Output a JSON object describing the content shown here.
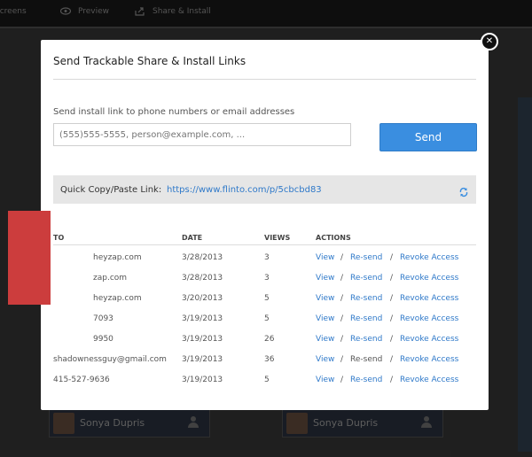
{
  "background": {
    "toolbar": {
      "screens_label": "Screens",
      "preview_label": "Preview",
      "share_label": "Share & Install"
    },
    "cards": [
      {
        "name": "Sonya Dupris"
      },
      {
        "name": "Sonya Dupris"
      }
    ]
  },
  "modal": {
    "title": "Send Trackable Share & Install Links",
    "instruction": "Send install link to phone numbers or email addresses",
    "input_placeholder": "(555)555-5555, person@example.com, ...",
    "send_label": "Send",
    "quick_label": "Quick Copy/Paste Link:",
    "quick_link": "https://www.flinto.com/p/5cbcbd83",
    "table": {
      "headers": {
        "to": "TO",
        "date": "DATE",
        "views": "VIEWS",
        "actions": "ACTIONS"
      },
      "rows": [
        {
          "to": "heyzap.com",
          "date": "3/28/2013",
          "views": "3",
          "view": "View",
          "resend": "Re-send",
          "revoke": "Revoke Access"
        },
        {
          "to": "zap.com",
          "date": "3/28/2013",
          "views": "3",
          "view": "View",
          "resend": "Re-send",
          "revoke": "Revoke Access"
        },
        {
          "to": "heyzap.com",
          "date": "3/20/2013",
          "views": "5",
          "view": "View",
          "resend": "Re-send",
          "revoke": "Revoke Access"
        },
        {
          "to": "7093",
          "date": "3/19/2013",
          "views": "5",
          "view": "View",
          "resend": "Re-send",
          "revoke": "Revoke Access"
        },
        {
          "to": "9950",
          "date": "3/19/2013",
          "views": "26",
          "view": "View",
          "resend": "Re-send",
          "revoke": "Revoke Access"
        },
        {
          "to": "shadownessguy@gmail.com",
          "date": "3/19/2013",
          "views": "36",
          "view": "View",
          "resend": "Re-send",
          "revoke": "Revoke Access"
        },
        {
          "to": "415-527-9636",
          "date": "3/19/2013",
          "views": "5",
          "view": "View",
          "resend": "Re-send",
          "revoke": "Revoke Access"
        }
      ],
      "separator": "/"
    }
  },
  "icons": {
    "close": "close-icon",
    "refresh": "refresh-icon",
    "eye": "eye-icon",
    "share": "share-icon",
    "person": "person-icon"
  },
  "colors": {
    "accent": "#3a8ee0",
    "link": "#2f79c9",
    "redaction": "#cc3d3d"
  }
}
